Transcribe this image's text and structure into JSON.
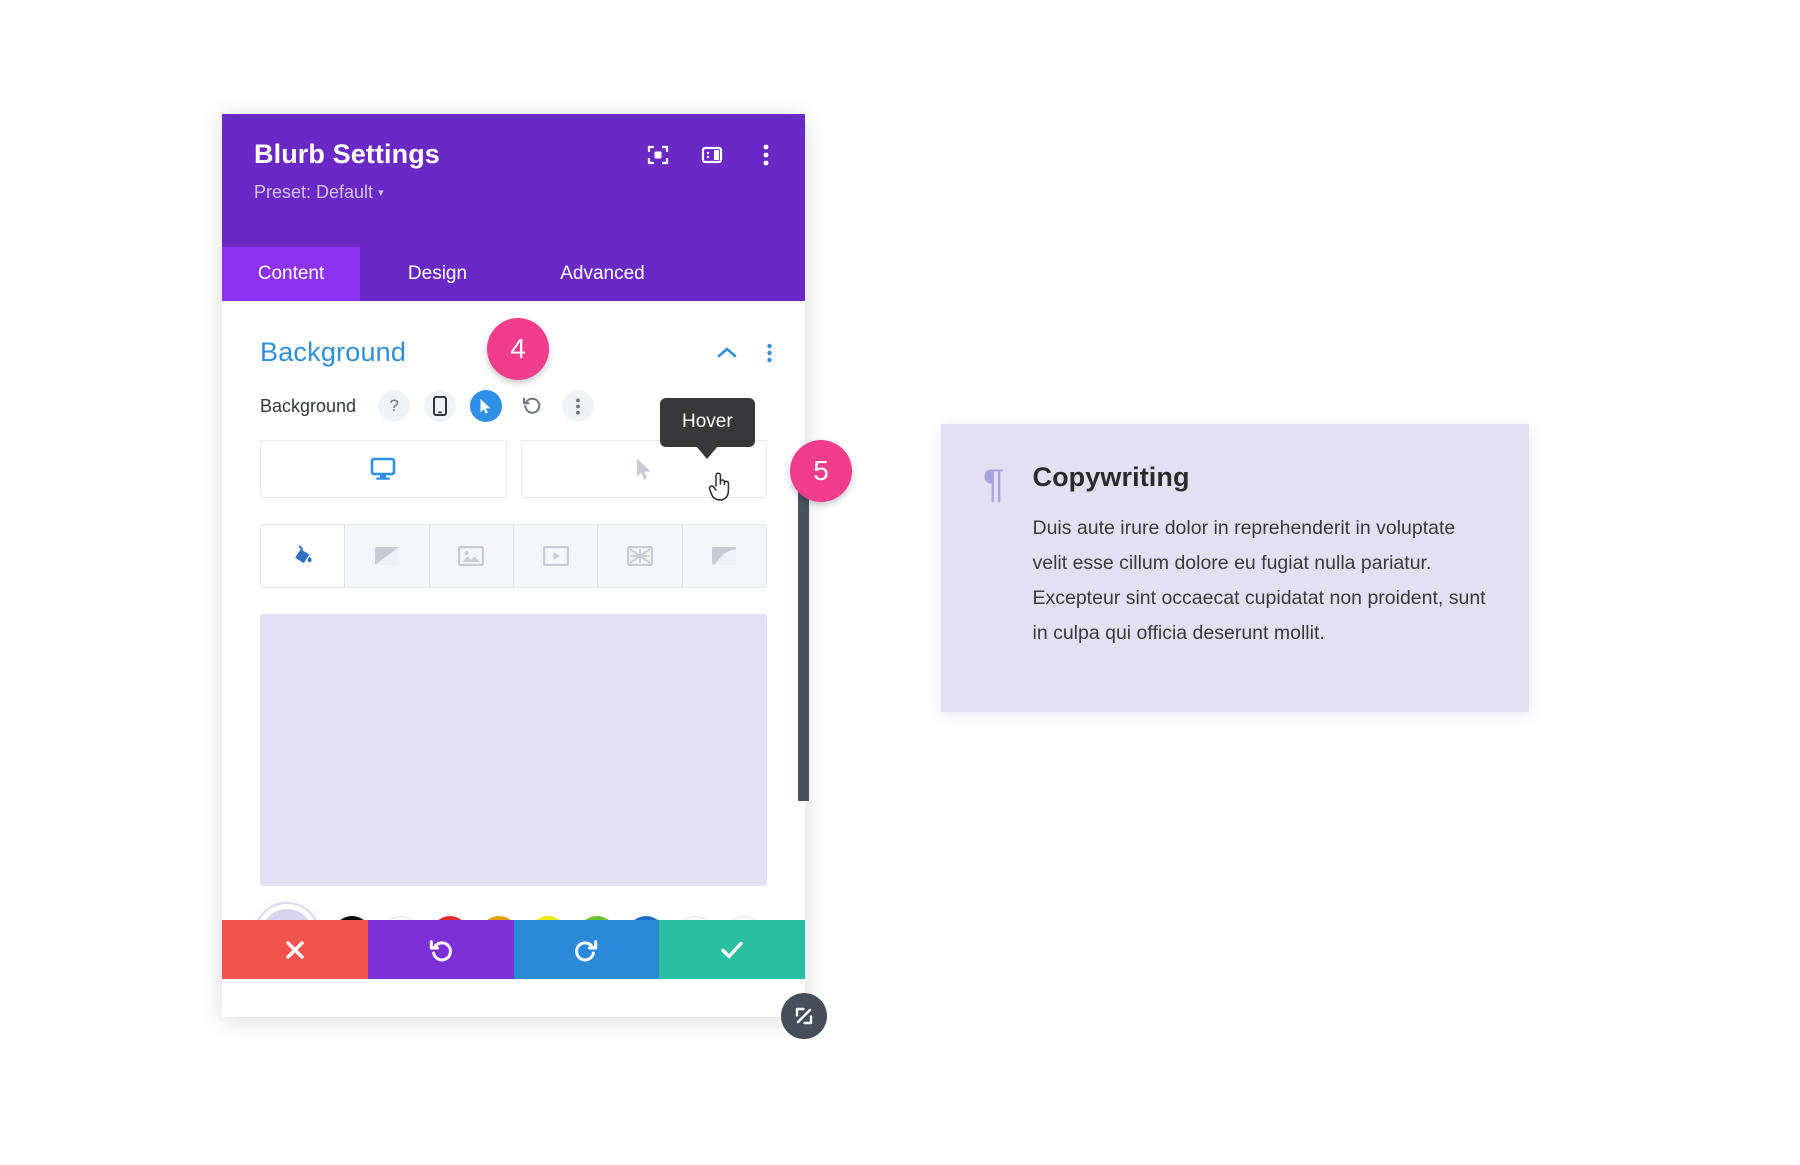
{
  "panel": {
    "title": "Blurb Settings",
    "preset_label": "Preset: Default",
    "preset_caret": "▾",
    "header_icons": [
      {
        "name": "focus-icon"
      },
      {
        "name": "layout-icon"
      },
      {
        "name": "kebab-menu-icon"
      }
    ],
    "tabs": [
      {
        "label": "Content",
        "active": true
      },
      {
        "label": "Design",
        "active": false
      },
      {
        "label": "Advanced",
        "active": false
      }
    ],
    "section": {
      "title": "Background",
      "collapse_icon": "chevron-up-icon",
      "menu_icon": "kebab-menu-icon"
    },
    "field": {
      "label": "Background",
      "help_glyph": "?",
      "reset_glyph": "↺",
      "more_glyph": "⋮"
    },
    "state_tabs": [
      {
        "name": "desktop",
        "active": true
      },
      {
        "name": "hover",
        "active": false
      }
    ],
    "background_types": [
      {
        "name": "color",
        "active": true
      },
      {
        "name": "gradient",
        "active": false
      },
      {
        "name": "image",
        "active": false
      },
      {
        "name": "video",
        "active": false
      },
      {
        "name": "pattern",
        "active": false
      },
      {
        "name": "mask",
        "active": false
      }
    ],
    "preview_color": "#E3E0F4",
    "swatches": [
      {
        "name": "eyedropper",
        "color": "#D9D5EE"
      },
      {
        "name": "black",
        "color": "#000000"
      },
      {
        "name": "white",
        "color": "#FFFFFF"
      },
      {
        "name": "red",
        "color": "#E02B2B"
      },
      {
        "name": "orange",
        "color": "#E0A010"
      },
      {
        "name": "yellow",
        "color": "#EDE90F"
      },
      {
        "name": "green",
        "color": "#67C32A"
      },
      {
        "name": "blue",
        "color": "#1D6FC4"
      },
      {
        "name": "white2",
        "color": "#FFFFFF"
      },
      {
        "name": "transparent",
        "color": "#FFFFFF"
      }
    ],
    "actions": [
      {
        "name": "cancel",
        "glyph": "✖",
        "color": "#F0544C"
      },
      {
        "name": "undo",
        "glyph": "↺",
        "color": "#7B2FD4"
      },
      {
        "name": "redo",
        "glyph": "↻",
        "color": "#2B8AD8"
      },
      {
        "name": "save",
        "glyph": "✔",
        "color": "#2ABF9E"
      }
    ],
    "resize_handle": "resize-diagonal-icon",
    "scrollbar": "vertical-scrollbar"
  },
  "tooltip": {
    "text": "Hover"
  },
  "badges": [
    {
      "number": "4"
    },
    {
      "number": "5"
    }
  ],
  "copy_card": {
    "icon": "pilcrow-icon",
    "icon_glyph": "¶",
    "title": "Copywriting",
    "text": "Duis aute irure dolor in reprehenderit in voluptate velit esse cillum dolore eu fugiat nulla pariatur. Excepteur sint occaecat cupidatat non proident, sunt in culpa qui officia deserunt mollit."
  },
  "colors": {
    "brand_purple": "#6A29C4",
    "tab_active": "#8C32F0",
    "accent_blue": "#2F8FD8",
    "badge_pink": "#F23D8C",
    "card_lavender": "#E3E0F4"
  }
}
